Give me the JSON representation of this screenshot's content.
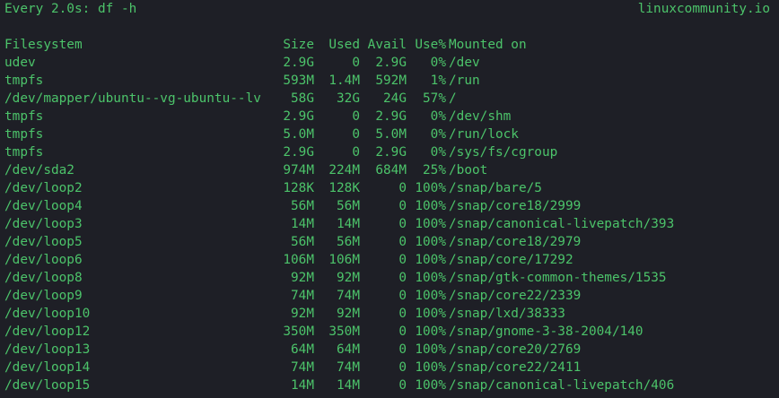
{
  "header": {
    "command": "Every 2.0s: df -h",
    "host": "linuxcommunity.io"
  },
  "columns": {
    "filesystem": "Filesystem",
    "size": "Size",
    "used": "Used",
    "avail": "Avail",
    "use_pct": "Use%",
    "mounted_on": "Mounted on"
  },
  "rows": [
    {
      "filesystem": "udev",
      "size": "2.9G",
      "used": "0",
      "avail": "2.9G",
      "use_pct": "0%",
      "mounted_on": "/dev"
    },
    {
      "filesystem": "tmpfs",
      "size": "593M",
      "used": "1.4M",
      "avail": "592M",
      "use_pct": "1%",
      "mounted_on": "/run"
    },
    {
      "filesystem": "/dev/mapper/ubuntu--vg-ubuntu--lv",
      "size": "58G",
      "used": "32G",
      "avail": "24G",
      "use_pct": "57%",
      "mounted_on": "/"
    },
    {
      "filesystem": "tmpfs",
      "size": "2.9G",
      "used": "0",
      "avail": "2.9G",
      "use_pct": "0%",
      "mounted_on": "/dev/shm"
    },
    {
      "filesystem": "tmpfs",
      "size": "5.0M",
      "used": "0",
      "avail": "5.0M",
      "use_pct": "0%",
      "mounted_on": "/run/lock"
    },
    {
      "filesystem": "tmpfs",
      "size": "2.9G",
      "used": "0",
      "avail": "2.9G",
      "use_pct": "0%",
      "mounted_on": "/sys/fs/cgroup"
    },
    {
      "filesystem": "/dev/sda2",
      "size": "974M",
      "used": "224M",
      "avail": "684M",
      "use_pct": "25%",
      "mounted_on": "/boot"
    },
    {
      "filesystem": "/dev/loop2",
      "size": "128K",
      "used": "128K",
      "avail": "0",
      "use_pct": "100%",
      "mounted_on": "/snap/bare/5"
    },
    {
      "filesystem": "/dev/loop4",
      "size": "56M",
      "used": "56M",
      "avail": "0",
      "use_pct": "100%",
      "mounted_on": "/snap/core18/2999"
    },
    {
      "filesystem": "/dev/loop3",
      "size": "14M",
      "used": "14M",
      "avail": "0",
      "use_pct": "100%",
      "mounted_on": "/snap/canonical-livepatch/393"
    },
    {
      "filesystem": "/dev/loop5",
      "size": "56M",
      "used": "56M",
      "avail": "0",
      "use_pct": "100%",
      "mounted_on": "/snap/core18/2979"
    },
    {
      "filesystem": "/dev/loop6",
      "size": "106M",
      "used": "106M",
      "avail": "0",
      "use_pct": "100%",
      "mounted_on": "/snap/core/17292"
    },
    {
      "filesystem": "/dev/loop8",
      "size": "92M",
      "used": "92M",
      "avail": "0",
      "use_pct": "100%",
      "mounted_on": "/snap/gtk-common-themes/1535"
    },
    {
      "filesystem": "/dev/loop9",
      "size": "74M",
      "used": "74M",
      "avail": "0",
      "use_pct": "100%",
      "mounted_on": "/snap/core22/2339"
    },
    {
      "filesystem": "/dev/loop10",
      "size": "92M",
      "used": "92M",
      "avail": "0",
      "use_pct": "100%",
      "mounted_on": "/snap/lxd/38333"
    },
    {
      "filesystem": "/dev/loop12",
      "size": "350M",
      "used": "350M",
      "avail": "0",
      "use_pct": "100%",
      "mounted_on": "/snap/gnome-3-38-2004/140"
    },
    {
      "filesystem": "/dev/loop13",
      "size": "64M",
      "used": "64M",
      "avail": "0",
      "use_pct": "100%",
      "mounted_on": "/snap/core20/2769"
    },
    {
      "filesystem": "/dev/loop14",
      "size": "74M",
      "used": "74M",
      "avail": "0",
      "use_pct": "100%",
      "mounted_on": "/snap/core22/2411"
    },
    {
      "filesystem": "/dev/loop15",
      "size": "14M",
      "used": "14M",
      "avail": "0",
      "use_pct": "100%",
      "mounted_on": "/snap/canonical-livepatch/406"
    }
  ]
}
